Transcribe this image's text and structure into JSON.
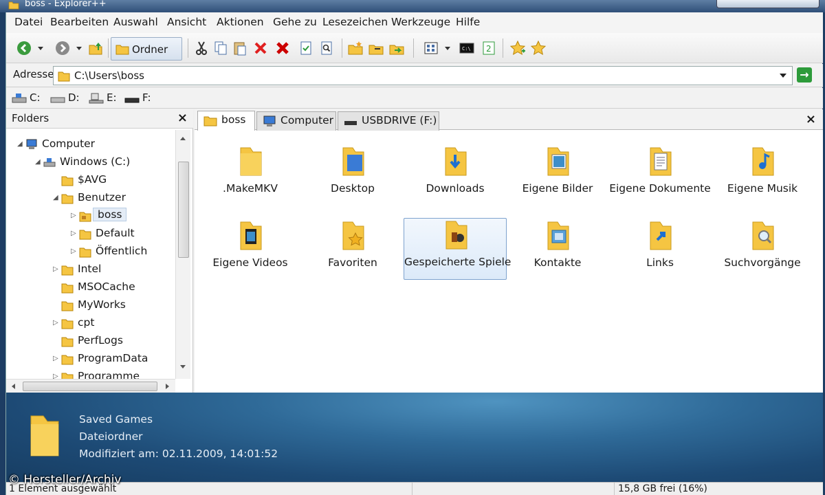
{
  "window": {
    "title": "boss - Explorer++"
  },
  "menu": [
    "Datei",
    "Bearbeiten",
    "Auswahl",
    "Ansicht",
    "Aktionen",
    "Gehe zu",
    "Lesezeichen",
    "Werkzeuge",
    "Hilfe"
  ],
  "toolbar": {
    "folders_label": "Ordner"
  },
  "address": {
    "label": "Adresse",
    "value": "C:\\Users\\boss"
  },
  "drives": [
    "C:",
    "D:",
    "E:",
    "F:"
  ],
  "folders_pane": {
    "title": "Folders",
    "tree": [
      "Computer",
      "Windows (C:)",
      "$AVG",
      "Benutzer",
      "boss",
      "Default",
      "Öffentlich",
      "Intel",
      "MSOCache",
      "MyWorks",
      "cpt",
      "PerfLogs",
      "ProgramData",
      "Programme"
    ]
  },
  "tabs": [
    "boss",
    "Computer",
    "USBDRIVE (F:)"
  ],
  "items": [
    ".MakeMKV",
    "Desktop",
    "Downloads",
    "Eigene Bilder",
    "Eigene Dokumente",
    "Eigene Musik",
    "Eigene Videos",
    "Favoriten",
    "Gespeicherte Spiele",
    "Kontakte",
    "Links",
    "Suchvorgänge"
  ],
  "details": {
    "name": "Saved Games",
    "type": "Dateiordner",
    "modified": "Modifiziert am: 02.11.2009, 14:01:52"
  },
  "status": {
    "left": "1 Element ausgewählt",
    "right": "15,8 GB frei (16%)"
  },
  "watermark": "© Hersteller/Archiv",
  "colors": {
    "folder": "#f5c542",
    "details_bg": "#2f6a98",
    "selection": "#dceaf9"
  }
}
